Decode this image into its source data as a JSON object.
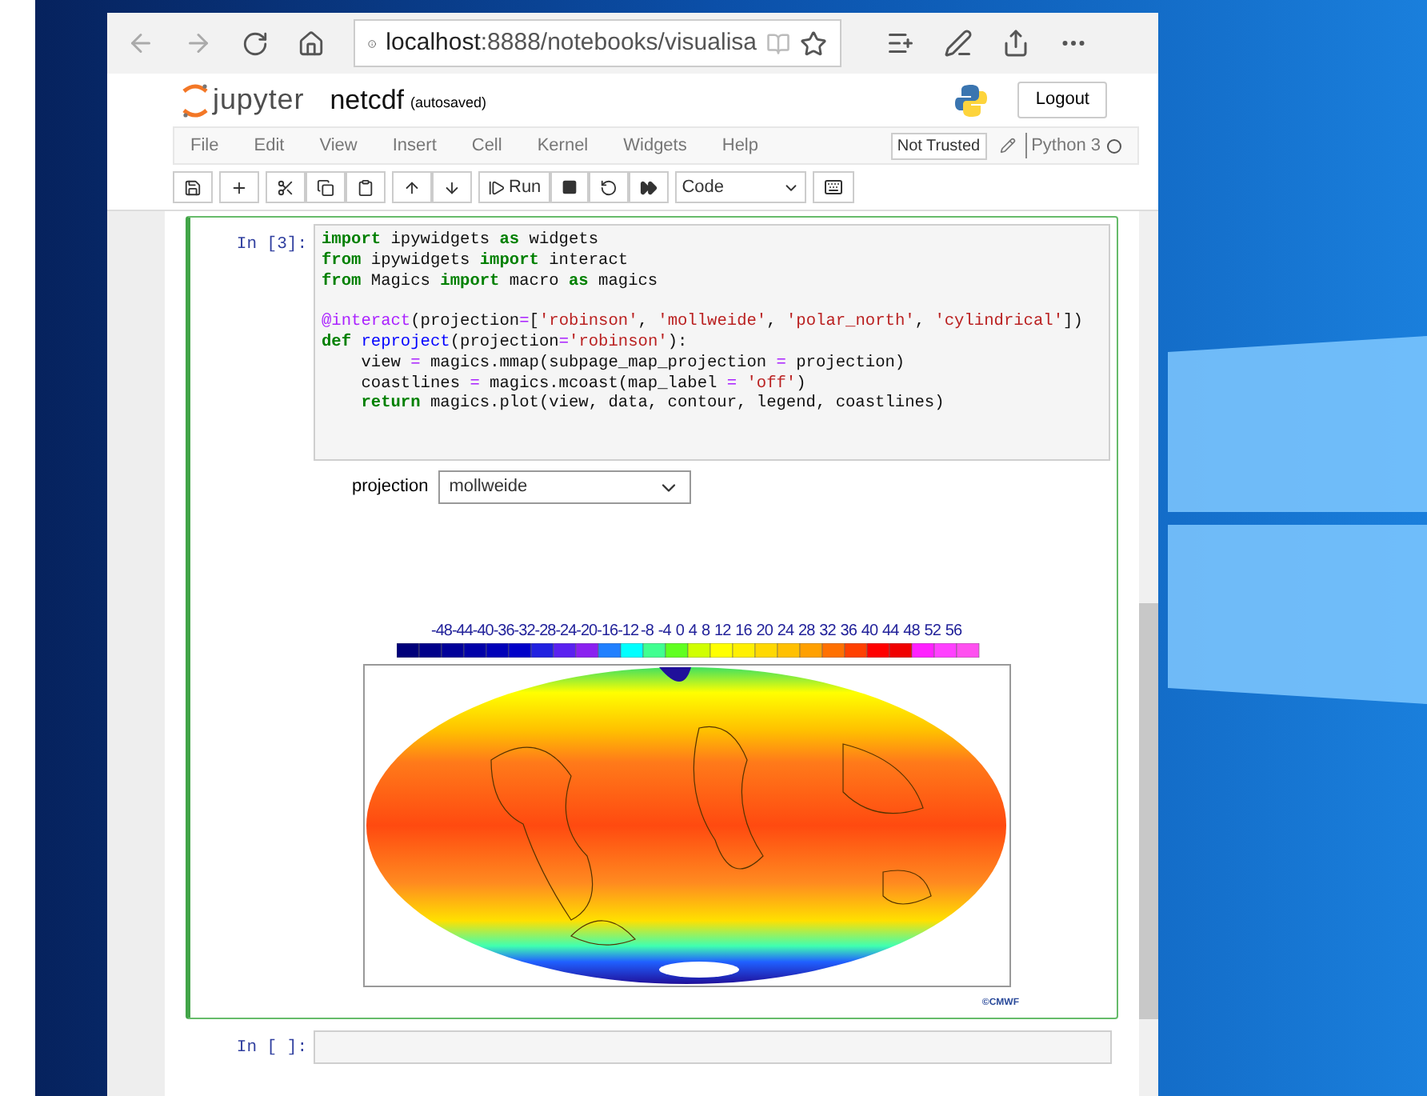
{
  "browser": {
    "url_host": "localhost",
    "url_rest": ":8888/notebooks/visualisa"
  },
  "jupyter": {
    "logo": "jupyter",
    "notebook_name": "netcdf",
    "save_status": "(autosaved)",
    "logout": "Logout"
  },
  "menu": [
    "File",
    "Edit",
    "View",
    "Insert",
    "Cell",
    "Kernel",
    "Widgets",
    "Help"
  ],
  "trust": "Not Trusted",
  "kernel": {
    "name": "Python 3",
    "busy": false
  },
  "toolbar": {
    "run": "Run",
    "cell_type": "Code"
  },
  "cell": {
    "prompt": "In [3]:",
    "selected": true,
    "lines": [
      {
        "spaced": false,
        "tokens": [
          {
            "kind": "keyword",
            "text": "import"
          },
          {
            "kind": "plain",
            "text": " ipywidgets "
          },
          {
            "kind": "keyword",
            "text": "as"
          },
          {
            "kind": "plain",
            "text": " widgets"
          }
        ]
      },
      {
        "spaced": false,
        "tokens": [
          {
            "kind": "keyword",
            "text": "from"
          },
          {
            "kind": "plain",
            "text": " ipywidgets "
          },
          {
            "kind": "keyword",
            "text": "import"
          },
          {
            "kind": "plain",
            "text": " interact"
          }
        ]
      },
      {
        "spaced": false,
        "tokens": [
          {
            "kind": "keyword",
            "text": "from"
          },
          {
            "kind": "plain",
            "text": " Magics "
          },
          {
            "kind": "keyword",
            "text": "import"
          },
          {
            "kind": "plain",
            "text": " macro "
          },
          {
            "kind": "keyword",
            "text": "as"
          },
          {
            "kind": "plain",
            "text": " magics"
          }
        ]
      },
      {
        "spaced": true,
        "tokens": [
          {
            "kind": "operator",
            "text": "@interact"
          },
          {
            "kind": "plain",
            "text": "(projection"
          },
          {
            "kind": "operator",
            "text": "="
          },
          {
            "kind": "plain",
            "text": "["
          },
          {
            "kind": "string",
            "text": "'robinson'"
          },
          {
            "kind": "plain",
            "text": ", "
          },
          {
            "kind": "string",
            "text": "'mollweide'"
          },
          {
            "kind": "plain",
            "text": ", "
          },
          {
            "kind": "string",
            "text": "'polar_north'"
          },
          {
            "kind": "plain",
            "text": ", "
          },
          {
            "kind": "string",
            "text": "'cylindrical'"
          },
          {
            "kind": "plain",
            "text": "])"
          }
        ]
      },
      {
        "spaced": false,
        "tokens": [
          {
            "kind": "keyword",
            "text": "def "
          },
          {
            "kind": "function",
            "text": "reproject"
          },
          {
            "kind": "plain",
            "text": "(projection"
          },
          {
            "kind": "operator",
            "text": "="
          },
          {
            "kind": "string",
            "text": "'robinson'"
          },
          {
            "kind": "plain",
            "text": "):"
          }
        ]
      },
      {
        "spaced": false,
        "tokens": [
          {
            "kind": "plain",
            "text": "    view "
          },
          {
            "kind": "operator",
            "text": "="
          },
          {
            "kind": "plain",
            "text": " magics.mmap(subpage_map_projection "
          },
          {
            "kind": "operator",
            "text": "="
          },
          {
            "kind": "plain",
            "text": " projection)"
          }
        ]
      },
      {
        "spaced": false,
        "tokens": [
          {
            "kind": "plain",
            "text": "    coastlines "
          },
          {
            "kind": "operator",
            "text": "="
          },
          {
            "kind": "plain",
            "text": " magics.mcoast(map_label "
          },
          {
            "kind": "operator",
            "text": "= "
          },
          {
            "kind": "string",
            "text": "'off'"
          },
          {
            "kind": "plain",
            "text": ")"
          }
        ]
      },
      {
        "spaced": false,
        "tokens": [
          {
            "kind": "keyword",
            "text": "    return"
          },
          {
            "kind": "plain",
            "text": " magics.plot(view, data, contour, legend, coastlines)"
          }
        ]
      }
    ],
    "widget": {
      "label": "projection",
      "value": "mollweide"
    },
    "colorbar_labels": [
      "-48",
      "-44",
      "-40",
      "-36",
      "-32",
      "-28",
      "-24",
      "-20",
      "-16",
      "-12",
      "-8",
      "-4",
      "0",
      "4",
      "8",
      "12",
      "16",
      "20",
      "24",
      "28",
      "32",
      "36",
      "40",
      "44",
      "48",
      "52",
      "56"
    ],
    "logo": "©CMWF"
  },
  "next_cell": {
    "prompt": "In [ ]:"
  }
}
